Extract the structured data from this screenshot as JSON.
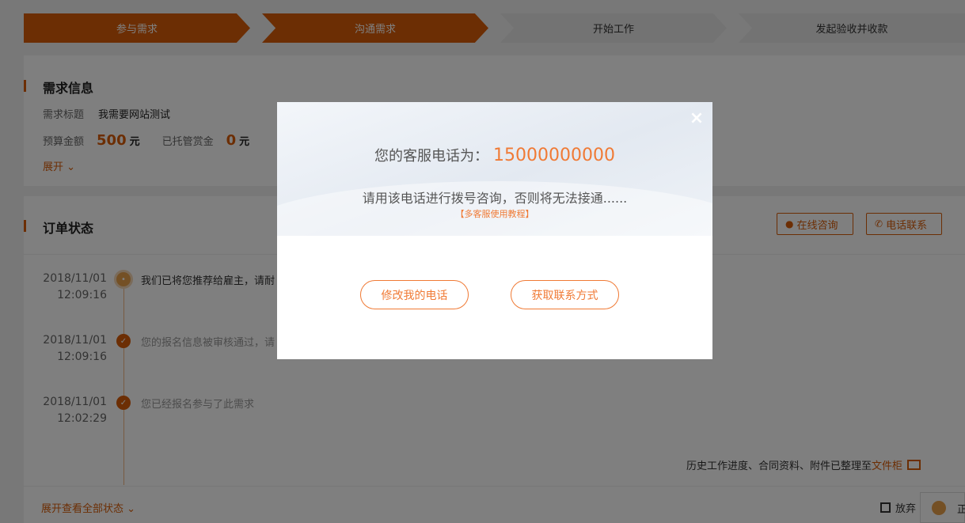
{
  "steps": [
    "参与需求",
    "沟通需求",
    "开始工作",
    "发起验收并收款"
  ],
  "requirement": {
    "section_title": "需求信息",
    "title_label": "需求标题",
    "title_value": "我需要网站测试",
    "budget_label": "预算金额",
    "budget_value": "500",
    "budget_unit": "元",
    "escrow_label": "已托管赏金",
    "escrow_value": "0",
    "escrow_unit": "元",
    "expand_label": "展开"
  },
  "order": {
    "section_title": "订单状态",
    "online_btn": "在线咨询",
    "phone_btn": "电话联系",
    "timeline": [
      {
        "date": "2018/11/01",
        "time": "12:09:16",
        "text": "我们已将您推荐给雇主，请耐"
      },
      {
        "date": "2018/11/01",
        "time": "12:09:16",
        "text": "您的报名信息被审核通过，请"
      },
      {
        "date": "2018/11/01",
        "time": "12:02:29",
        "text": "您已经报名参与了此需求"
      }
    ],
    "archive_text": "历史工作进度、合同资料、附件已整理至",
    "archive_link": "文件柜",
    "expand_all": "展开查看全部状态",
    "give_up": "放弃"
  },
  "widget_text": "正",
  "modal": {
    "phone_label": "您的客服电话为：",
    "phone_number": "15000000000",
    "note": "请用该电话进行拨号咨询，否则将无法接通......",
    "tutorial_link": "【多客服使用教程】",
    "btn_modify": "修改我的电话",
    "btn_get_contact": "获取联系方式",
    "close_glyph": "×"
  },
  "colors": {
    "accent": "#d95d08",
    "modal_accent": "#f07a35"
  }
}
